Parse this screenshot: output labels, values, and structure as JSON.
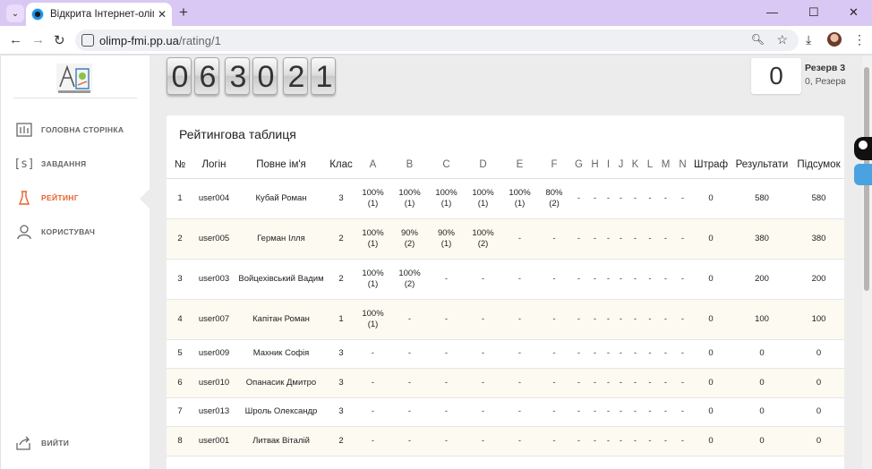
{
  "browser": {
    "tab_title": "Відкрита Інтернет-олімпіада Р",
    "url_host": "olimp-fmi.pp.ua",
    "url_path": "/rating/1"
  },
  "sidebar": {
    "items": [
      {
        "label": "ГОЛОВНА СТОРІНКА",
        "icon": "home-icon"
      },
      {
        "label": "ЗАВДАННЯ",
        "icon": "tasks-icon"
      },
      {
        "label": "РЕЙТИНГ",
        "icon": "rating-icon"
      },
      {
        "label": "КОРИСТУВАЧ",
        "icon": "user-icon"
      }
    ],
    "logout": "ВИЙТИ"
  },
  "timer": [
    "0",
    "6",
    "3",
    "0",
    "2",
    "1"
  ],
  "score": "0",
  "user": {
    "name": "Резерв 3",
    "sub": "0, Резерв"
  },
  "rating": {
    "title": "Рейтингова таблиця",
    "columns": [
      "№",
      "Логін",
      "Повне ім'я",
      "Клас",
      "A",
      "B",
      "C",
      "D",
      "E",
      "F",
      "G",
      "H",
      "I",
      "J",
      "K",
      "L",
      "M",
      "N",
      "Штраф",
      "Результати",
      "Підсумок"
    ],
    "rows": [
      [
        "1",
        "user004",
        "Кубай Роман",
        "3",
        "100%|(1)",
        "100%|(1)",
        "100%|(1)",
        "100%|(1)",
        "100%|(1)",
        "80%|(2)",
        "-",
        "-",
        "-",
        "-",
        "-",
        "-",
        "-",
        "-",
        "0",
        "580",
        "580"
      ],
      [
        "2",
        "user005",
        "Герман Ілля",
        "2",
        "100%|(1)",
        "90%|(2)",
        "90%|(1)",
        "100%|(2)",
        "-",
        "-",
        "-",
        "-",
        "-",
        "-",
        "-",
        "-",
        "-",
        "-",
        "0",
        "380",
        "380"
      ],
      [
        "3",
        "user003",
        "Войцехівський Вадим",
        "2",
        "100%|(1)",
        "100%|(2)",
        "-",
        "-",
        "-",
        "-",
        "-",
        "-",
        "-",
        "-",
        "-",
        "-",
        "-",
        "-",
        "0",
        "200",
        "200"
      ],
      [
        "4",
        "user007",
        "Капітан Роман",
        "1",
        "100%|(1)",
        "-",
        "-",
        "-",
        "-",
        "-",
        "-",
        "-",
        "-",
        "-",
        "-",
        "-",
        "-",
        "-",
        "0",
        "100",
        "100"
      ],
      [
        "5",
        "user009",
        "Махник Софія",
        "3",
        "-",
        "-",
        "-",
        "-",
        "-",
        "-",
        "-",
        "-",
        "-",
        "-",
        "-",
        "-",
        "-",
        "-",
        "0",
        "0",
        "0"
      ],
      [
        "6",
        "user010",
        "Опанасик Дмитро",
        "3",
        "-",
        "-",
        "-",
        "-",
        "-",
        "-",
        "-",
        "-",
        "-",
        "-",
        "-",
        "-",
        "-",
        "-",
        "0",
        "0",
        "0"
      ],
      [
        "7",
        "user013",
        "Шроль Олександр",
        "3",
        "-",
        "-",
        "-",
        "-",
        "-",
        "-",
        "-",
        "-",
        "-",
        "-",
        "-",
        "-",
        "-",
        "-",
        "0",
        "0",
        "0"
      ],
      [
        "8",
        "user001",
        "Литвак Віталій",
        "2",
        "-",
        "-",
        "-",
        "-",
        "-",
        "-",
        "-",
        "-",
        "-",
        "-",
        "-",
        "-",
        "-",
        "-",
        "0",
        "0",
        "0"
      ]
    ]
  }
}
